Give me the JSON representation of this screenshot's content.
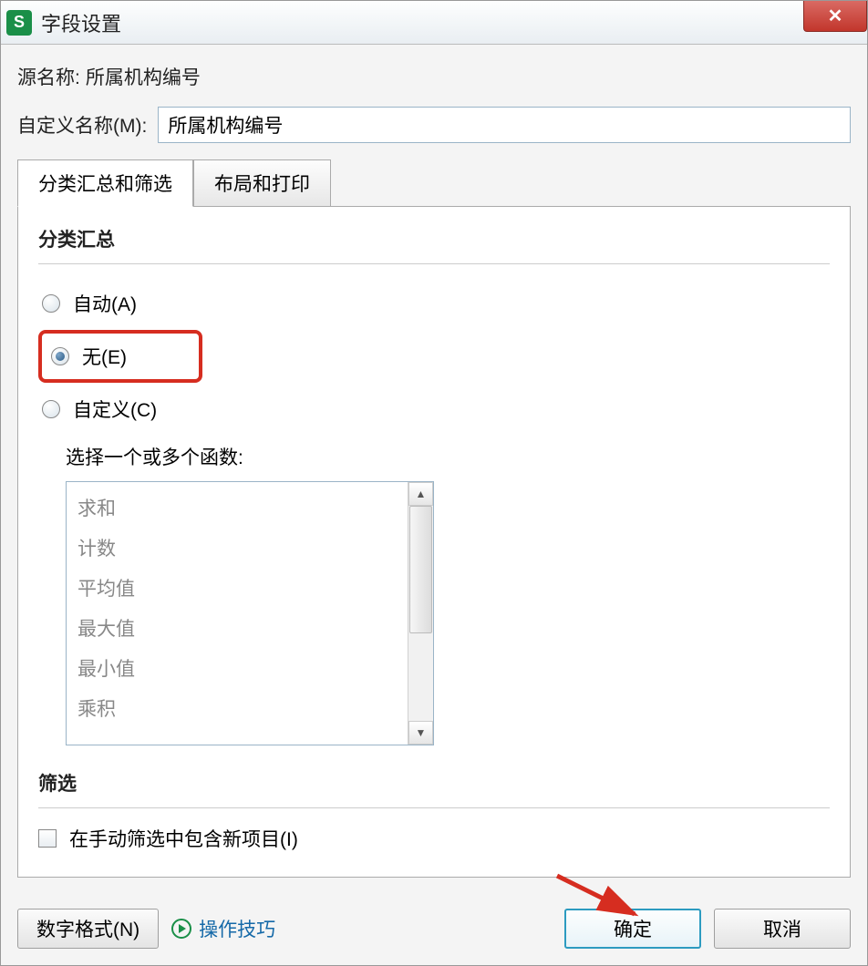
{
  "title": "字段设置",
  "source_label": "源名称:",
  "source_value": "所属机构编号",
  "custom_label": "自定义名称(M):",
  "custom_value": "所属机构编号",
  "tabs": {
    "summary_filter": "分类汇总和筛选",
    "layout_print": "布局和打印"
  },
  "panel": {
    "subtotal_title": "分类汇总",
    "radios": {
      "auto": "自动(A)",
      "none": "无(E)",
      "custom": "自定义(C)"
    },
    "func_label": "选择一个或多个函数:",
    "functions": [
      "求和",
      "计数",
      "平均值",
      "最大值",
      "最小值",
      "乘积"
    ],
    "filter_title": "筛选",
    "include_new_items": "在手动筛选中包含新项目(I)"
  },
  "footer": {
    "number_format": "数字格式(N)",
    "tips": "操作技巧",
    "ok": "确定",
    "cancel": "取消"
  }
}
